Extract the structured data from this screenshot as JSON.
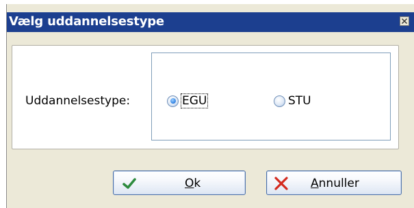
{
  "dialog": {
    "title": "Vælg uddannelsestype",
    "close_label": "Close"
  },
  "form": {
    "field_label": "Uddannelsestype:",
    "options": [
      {
        "label": "EGU",
        "selected": true,
        "focused": true
      },
      {
        "label": "STU",
        "selected": false,
        "focused": false
      }
    ]
  },
  "buttons": {
    "ok": {
      "mnemonic": "O",
      "rest": "k",
      "icon": "checkmark-icon"
    },
    "cancel": {
      "mnemonic": "A",
      "rest": "nnuller",
      "icon": "cross-icon"
    }
  },
  "colors": {
    "titlebar": "#1c3f8f",
    "window_bg": "#ece9d8",
    "checkmark": "#2e8b3e",
    "cross": "#d42a1e"
  }
}
